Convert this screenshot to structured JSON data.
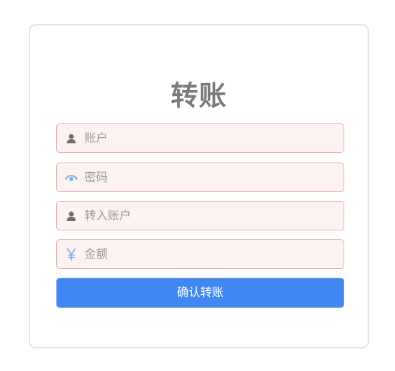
{
  "form": {
    "title": "转账",
    "fields": [
      {
        "placeholder": "账户",
        "icon": "user-icon",
        "value": ""
      },
      {
        "placeholder": "密码",
        "icon": "eye-icon",
        "value": ""
      },
      {
        "placeholder": "转入账户",
        "icon": "user-icon",
        "value": ""
      },
      {
        "placeholder": "金额",
        "icon": "yen-icon",
        "value": ""
      }
    ],
    "submit_label": "确认转账"
  },
  "colors": {
    "title": "#7b7b7b",
    "field_border": "#e7a9a9",
    "field_background": "#fdf2f2",
    "button": "#4187f4",
    "user_icon": "#6e6e6e",
    "accent_icon": "#7fb0e6"
  }
}
